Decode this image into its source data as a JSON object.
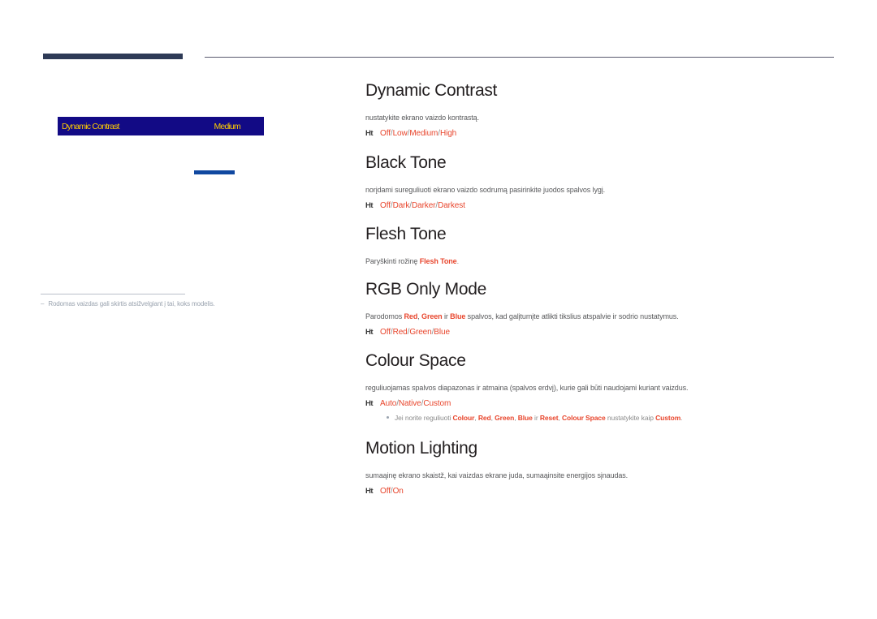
{
  "page": {
    "language": "lt",
    "accent_red": "#e8452c",
    "osd_bg": "#120a85",
    "osd_fg": "#ffcc00",
    "header_bar_color": "#2e3a56",
    "blue_accent_color": "#1048a0"
  },
  "osd": {
    "menu_label": "Dynamic Contrast",
    "menu_value": "Medium"
  },
  "footnote": {
    "dash": "‒",
    "text": "Rodomas vaizdas gali skirtis atsižvelgiant į tai, koks modelis."
  },
  "sections": [
    {
      "id": "dynamic-contrast",
      "title": "Dynamic Contrast",
      "description": "nustatykite ekrano vaizdo kontrastą.",
      "marker": "Ht",
      "options": [
        "Off",
        "Low",
        "Medium",
        "High"
      ],
      "separator": "/"
    },
    {
      "id": "black-tone",
      "title": "Black Tone",
      "description": "norįdami sureguliuoti ekrano vaizdo sodrumą pasirinkite juodos spalvos lygį.",
      "marker": "Ht",
      "options": [
        "Off",
        "Dark",
        "Darker",
        "Darkest"
      ],
      "separator": "/"
    },
    {
      "id": "flesh-tone",
      "title": "Flesh Tone",
      "description_prefix": "Paryškinti rožinę ",
      "description_highlight": "Flesh Tone",
      "description_suffix": "."
    },
    {
      "id": "rgb-only-mode",
      "title": "RGB Only Mode",
      "desc_p1": "Parodomos ",
      "desc_red": "Red",
      "desc_c1": ", ",
      "desc_green": "Green",
      "desc_c2": " ir ",
      "desc_blue": "Blue",
      "desc_p2": " spalvos, kad galįtumįte atlikti tikslius atspalvie ir sodrio nustatymus.",
      "marker": "Ht",
      "options": [
        "Off",
        "Red",
        "Green",
        "Blue"
      ],
      "separator": "/"
    },
    {
      "id": "colour-space",
      "title": "Colour Space",
      "description": "reguliuojamas spalvos diapazonas ir atmaina (spalvos erdvį), kurie gali būti naudojami kuriant vaizdus.",
      "marker": "Ht",
      "options": [
        "Auto",
        "Native",
        "Custom"
      ],
      "separator": "/",
      "sub_note": {
        "p1": "Jei norite reguliuoti ",
        "t1": "Colour",
        "c1": ", ",
        "t2": "Red",
        "c2": ", ",
        "t3": "Green",
        "c3": ", ",
        "t4": "Blue",
        "c4": " ir ",
        "t5": "Reset",
        "c5": ", ",
        "t6": "Colour Space",
        "p2": " nustatykite kaip ",
        "t7": "Custom",
        "p3": "."
      }
    },
    {
      "id": "motion-lighting",
      "title": "Motion Lighting",
      "description": "sumaąinę ekrano skaistž, kai vaizdas ekrane juda, sumaąinsite energijos sįnaudas.",
      "marker": "Ht",
      "options": [
        "Off",
        "On"
      ],
      "separator": "/"
    }
  ]
}
